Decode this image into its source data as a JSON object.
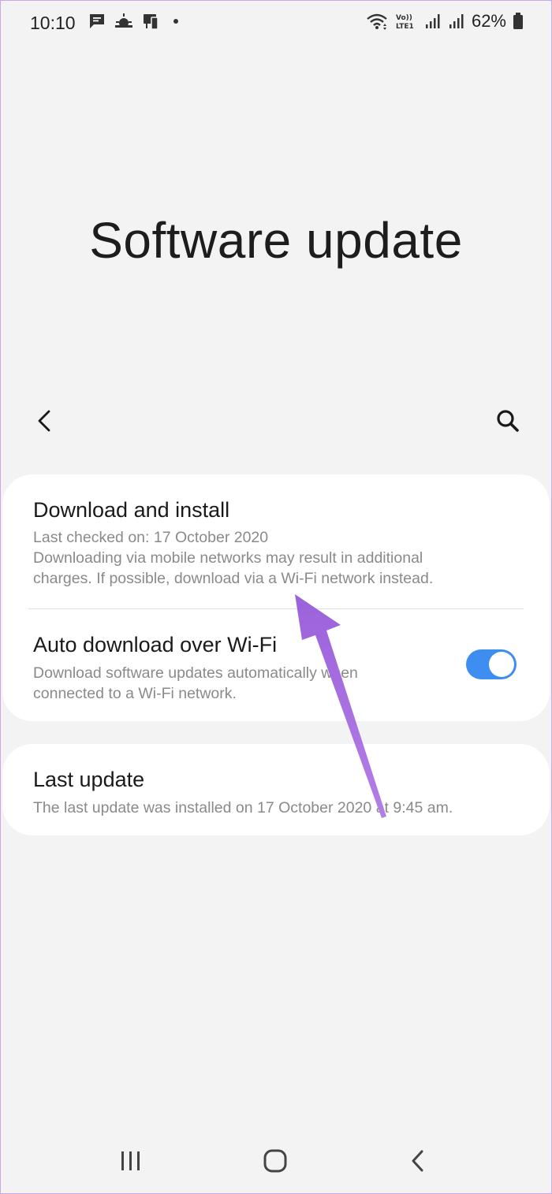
{
  "status_bar": {
    "time": "10:10",
    "battery": "62%",
    "network": "LTE1",
    "volte": "Vo))",
    "icons": [
      "message-icon",
      "weather-icon",
      "screencast-icon",
      "wifi-icon",
      "signal-icon",
      "battery-icon"
    ]
  },
  "page": {
    "title": "Software update"
  },
  "toolbar": {
    "back_icon": "chevron-left-icon",
    "search_icon": "search-icon"
  },
  "items": {
    "download": {
      "title": "Download and install",
      "last_checked": "Last checked on: 17 October 2020",
      "note_line1": "Downloading via mobile networks may result in additional",
      "note_line2": "charges. If possible, download via a Wi-Fi network instead."
    },
    "auto_download": {
      "title": "Auto download over Wi-Fi",
      "desc_line1": "Download software updates automatically when",
      "desc_line2": "connected to a Wi-Fi network.",
      "enabled": true
    },
    "last_update": {
      "title": "Last update",
      "desc": "The last update was installed on 17 October 2020 at 9:45 am."
    }
  },
  "nav": {
    "recents_icon": "recents-icon",
    "home_icon": "home-icon",
    "back_icon": "nav-back-icon"
  },
  "colors": {
    "background": "#f3f3f3",
    "card": "#ffffff",
    "toggle_on": "#3e8df0",
    "annotation_arrow": "#a66de0"
  }
}
